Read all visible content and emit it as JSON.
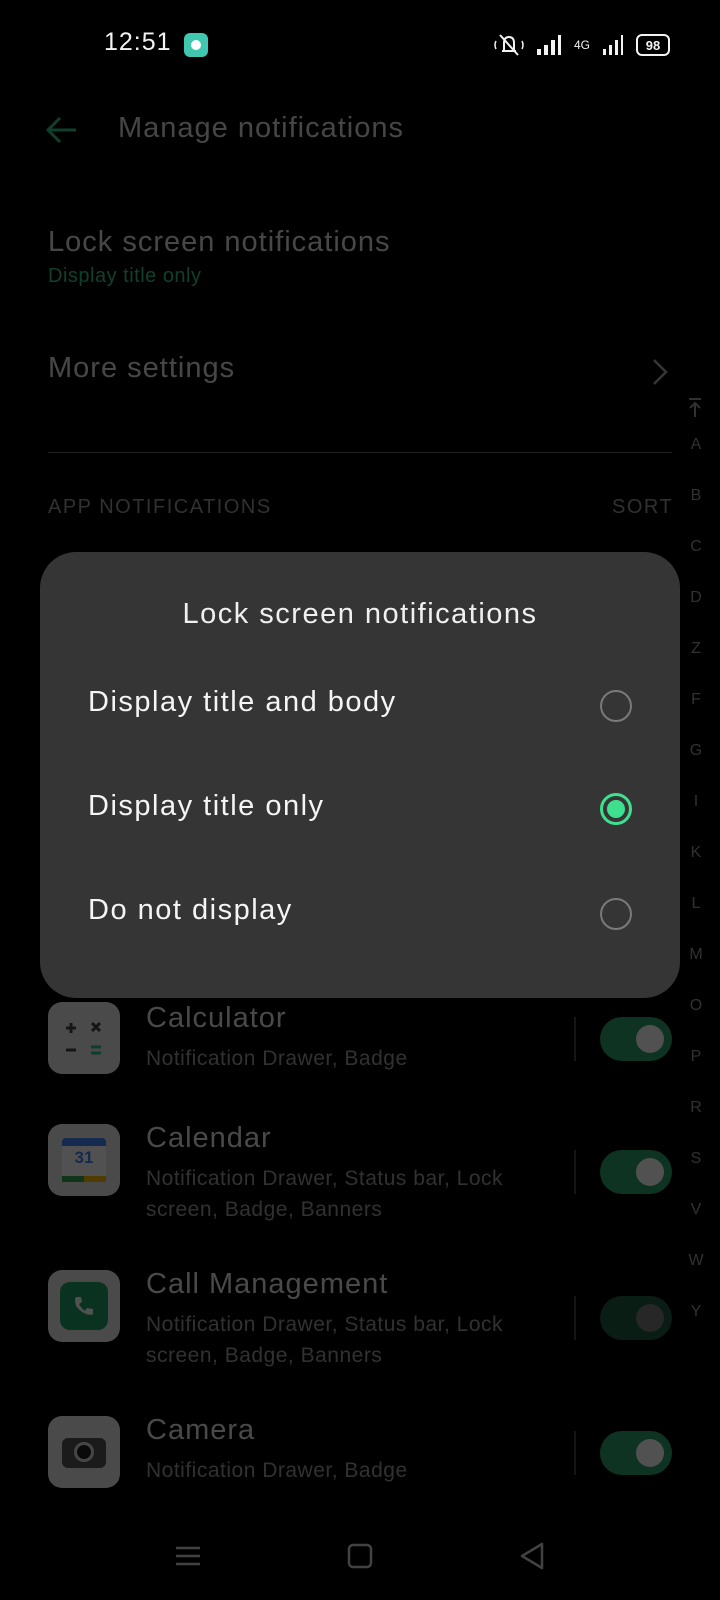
{
  "status_bar": {
    "time": "12:51",
    "battery": "98",
    "network": "4G"
  },
  "header": {
    "title": "Manage notifications"
  },
  "settings": {
    "lock_screen_title": "Lock screen notifications",
    "lock_screen_value": "Display title only",
    "more_settings": "More settings"
  },
  "app_section": {
    "header": "APP NOTIFICATIONS",
    "sort": "SORT",
    "alphabet": [
      "A",
      "B",
      "C",
      "D",
      "Z",
      "F",
      "G",
      "I",
      "K",
      "L",
      "M",
      "O",
      "P",
      "R",
      "S",
      "V",
      "W",
      "Y"
    ]
  },
  "apps": [
    {
      "name": "Calculator",
      "detail": "Notification Drawer, Badge",
      "enabled": true
    },
    {
      "name": "Calendar",
      "detail": "Notification Drawer, Status bar, Lock screen, Badge, Banners",
      "enabled": true,
      "icon_text": "31"
    },
    {
      "name": "Call Management",
      "detail": "Notification Drawer, Status bar, Lock screen, Badge, Banners",
      "enabled": false
    },
    {
      "name": "Camera",
      "detail": "Notification Drawer, Badge",
      "enabled": true
    }
  ],
  "dialog": {
    "title": "Lock screen notifications",
    "options": [
      {
        "label": "Display title and body",
        "selected": false
      },
      {
        "label": "Display title only",
        "selected": true
      },
      {
        "label": "Do not display",
        "selected": false
      }
    ]
  },
  "colors": {
    "accent": "#3ee08f",
    "dialog_bg": "#353535",
    "background": "#000000"
  },
  "icons": {
    "back": "arrow-left-icon",
    "chevron": "chevron-right-icon",
    "nav_menu": "menu-icon",
    "nav_home": "square-icon",
    "nav_back": "triangle-back-icon"
  }
}
